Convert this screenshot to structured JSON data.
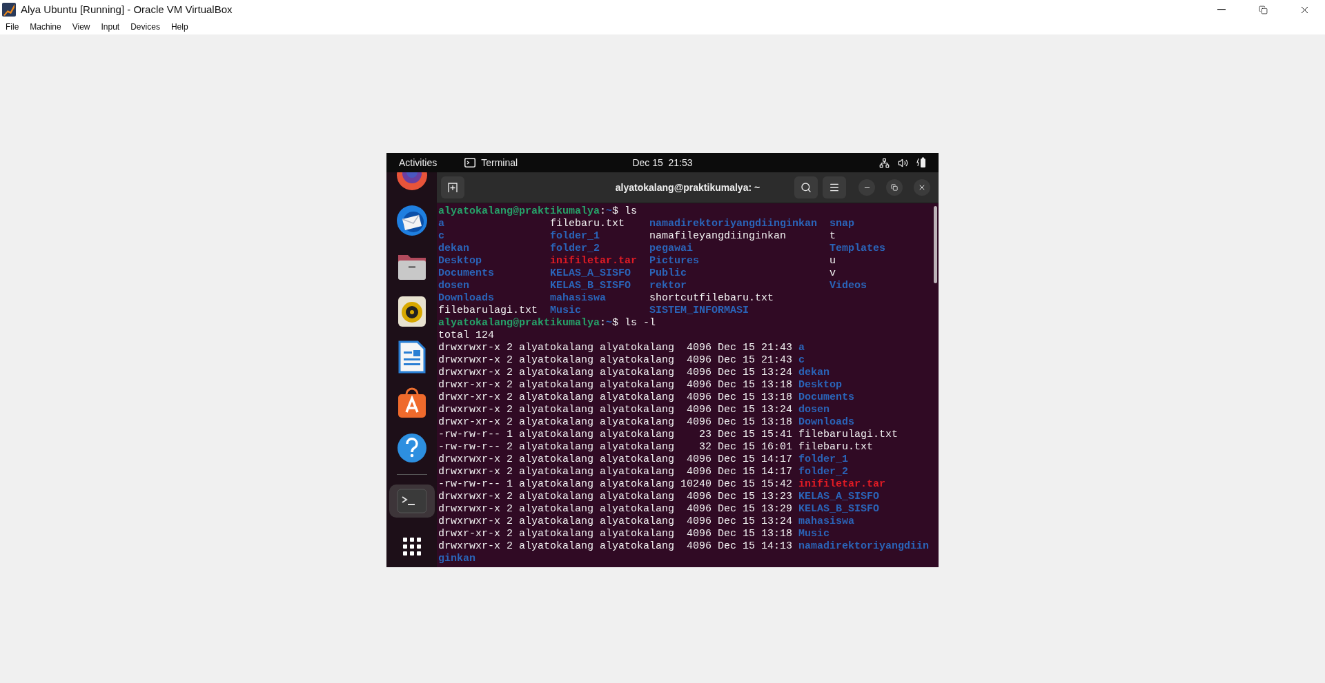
{
  "window": {
    "title": "Alya Ubuntu [Running] - Oracle VM VirtualBox",
    "menu": [
      "File",
      "Machine",
      "View",
      "Input",
      "Devices",
      "Help"
    ]
  },
  "topbar": {
    "activities": "Activities",
    "app": "Terminal",
    "clock": "Dec 15  21:53"
  },
  "dock": [
    {
      "kind": "browser",
      "selected": false
    },
    {
      "kind": "mail",
      "selected": false
    },
    {
      "kind": "files",
      "selected": false
    },
    {
      "kind": "music",
      "selected": false
    },
    {
      "kind": "writer",
      "selected": false
    },
    {
      "kind": "store",
      "selected": false
    },
    {
      "kind": "help",
      "selected": false
    },
    {
      "kind": "separator"
    },
    {
      "kind": "terminal",
      "selected": true
    },
    {
      "kind": "apps",
      "selected": false
    }
  ],
  "terminal": {
    "title": "alyatokalang@praktikumalya: ~",
    "lines": [
      {
        "kind": "prompt",
        "user": "alyatokalang@praktikumalya",
        "separator": ":",
        "path": "~",
        "command": "$ ls"
      },
      {
        "kind": "ls",
        "columns": [
          [
            {
              "name": "a",
              "kind": "dir"
            },
            {
              "name": "c",
              "kind": "dir"
            },
            {
              "name": "dekan",
              "kind": "dir"
            },
            {
              "name": "Desktop",
              "kind": "dir"
            },
            {
              "name": "Documents",
              "kind": "dir"
            },
            {
              "name": "dosen",
              "kind": "dir"
            },
            {
              "name": "Downloads",
              "kind": "dir"
            },
            {
              "name": "filebarulagi.txt",
              "kind": "file"
            }
          ],
          [
            {
              "name": "filebaru.txt",
              "kind": "file"
            },
            {
              "name": "folder_1",
              "kind": "dir"
            },
            {
              "name": "folder_2",
              "kind": "dir"
            },
            {
              "name": "inifiletar.tar",
              "kind": "archive"
            },
            {
              "name": "KELAS_A_SISFO",
              "kind": "dir"
            },
            {
              "name": "KELAS_B_SISFO",
              "kind": "dir"
            },
            {
              "name": "mahasiswa",
              "kind": "dir"
            },
            {
              "name": "Music",
              "kind": "dir"
            }
          ],
          [
            {
              "name": "namadirektoriyangdiinginkan",
              "kind": "dir"
            },
            {
              "name": "namafileyangdiinginkan",
              "kind": "file"
            },
            {
              "name": "pegawai",
              "kind": "dir"
            },
            {
              "name": "Pictures",
              "kind": "dir"
            },
            {
              "name": "Public",
              "kind": "dir"
            },
            {
              "name": "rektor",
              "kind": "dir"
            },
            {
              "name": "shortcutfilebaru.txt",
              "kind": "file"
            },
            {
              "name": "SISTEM_INFORMASI",
              "kind": "dir"
            }
          ],
          [
            {
              "name": "snap",
              "kind": "dir"
            },
            {
              "name": "t",
              "kind": "file"
            },
            {
              "name": "Templates",
              "kind": "dir"
            },
            {
              "name": "u",
              "kind": "file"
            },
            {
              "name": "v",
              "kind": "file"
            },
            {
              "name": "Videos",
              "kind": "dir"
            }
          ]
        ]
      },
      {
        "kind": "prompt",
        "user": "alyatokalang@praktikumalya",
        "separator": ":",
        "path": "~",
        "command": "$ ls -l"
      },
      {
        "kind": "text",
        "text": "total 124"
      },
      {
        "kind": "entry",
        "details": "drwxrwxr-x 2 alyatokalang alyatokalang  4096 Dec 15 21:43",
        "file": {
          "name": "a",
          "kind": "dir"
        }
      },
      {
        "kind": "entry",
        "details": "drwxrwxr-x 2 alyatokalang alyatokalang  4096 Dec 15 21:43",
        "file": {
          "name": "c",
          "kind": "dir"
        }
      },
      {
        "kind": "entry",
        "details": "drwxrwxr-x 2 alyatokalang alyatokalang  4096 Dec 15 13:24",
        "file": {
          "name": "dekan",
          "kind": "dir"
        }
      },
      {
        "kind": "entry",
        "details": "drwxr-xr-x 2 alyatokalang alyatokalang  4096 Dec 15 13:18",
        "file": {
          "name": "Desktop",
          "kind": "dir"
        }
      },
      {
        "kind": "entry",
        "details": "drwxr-xr-x 2 alyatokalang alyatokalang  4096 Dec 15 13:18",
        "file": {
          "name": "Documents",
          "kind": "dir"
        }
      },
      {
        "kind": "entry",
        "details": "drwxrwxr-x 2 alyatokalang alyatokalang  4096 Dec 15 13:24",
        "file": {
          "name": "dosen",
          "kind": "dir"
        }
      },
      {
        "kind": "entry",
        "details": "drwxr-xr-x 2 alyatokalang alyatokalang  4096 Dec 15 13:18",
        "file": {
          "name": "Downloads",
          "kind": "dir"
        }
      },
      {
        "kind": "entry",
        "details": "-rw-rw-r-- 1 alyatokalang alyatokalang    23 Dec 15 15:41",
        "file": {
          "name": "filebarulagi.txt",
          "kind": "file"
        }
      },
      {
        "kind": "entry",
        "details": "-rw-rw-r-- 2 alyatokalang alyatokalang    32 Dec 15 16:01",
        "file": {
          "name": "filebaru.txt",
          "kind": "file"
        }
      },
      {
        "kind": "entry",
        "details": "drwxrwxr-x 2 alyatokalang alyatokalang  4096 Dec 15 14:17",
        "file": {
          "name": "folder_1",
          "kind": "dir"
        }
      },
      {
        "kind": "entry",
        "details": "drwxrwxr-x 2 alyatokalang alyatokalang  4096 Dec 15 14:17",
        "file": {
          "name": "folder_2",
          "kind": "dir"
        }
      },
      {
        "kind": "entry",
        "details": "-rw-rw-r-- 1 alyatokalang alyatokalang 10240 Dec 15 15:42",
        "file": {
          "name": "inifiletar.tar",
          "kind": "archive"
        }
      },
      {
        "kind": "entry",
        "details": "drwxrwxr-x 2 alyatokalang alyatokalang  4096 Dec 15 13:23",
        "file": {
          "name": "KELAS_A_SISFO",
          "kind": "dir"
        }
      },
      {
        "kind": "entry",
        "details": "drwxrwxr-x 2 alyatokalang alyatokalang  4096 Dec 15 13:29",
        "file": {
          "name": "KELAS_B_SISFO",
          "kind": "dir"
        }
      },
      {
        "kind": "entry",
        "details": "drwxrwxr-x 2 alyatokalang alyatokalang  4096 Dec 15 13:24",
        "file": {
          "name": "mahasiswa",
          "kind": "dir"
        }
      },
      {
        "kind": "entry",
        "details": "drwxr-xr-x 2 alyatokalang alyatokalang  4096 Dec 15 13:18",
        "file": {
          "name": "Music",
          "kind": "dir"
        }
      },
      {
        "kind": "entry",
        "details": "drwxrwxr-x 2 alyatokalang alyatokalang  4096 Dec 15 14:13",
        "file": {
          "name": "namadirektoriyangdiin",
          "kind": "dir"
        }
      },
      {
        "kind": "continuation",
        "file": {
          "name": "ginkan",
          "kind": "dir"
        }
      }
    ]
  }
}
